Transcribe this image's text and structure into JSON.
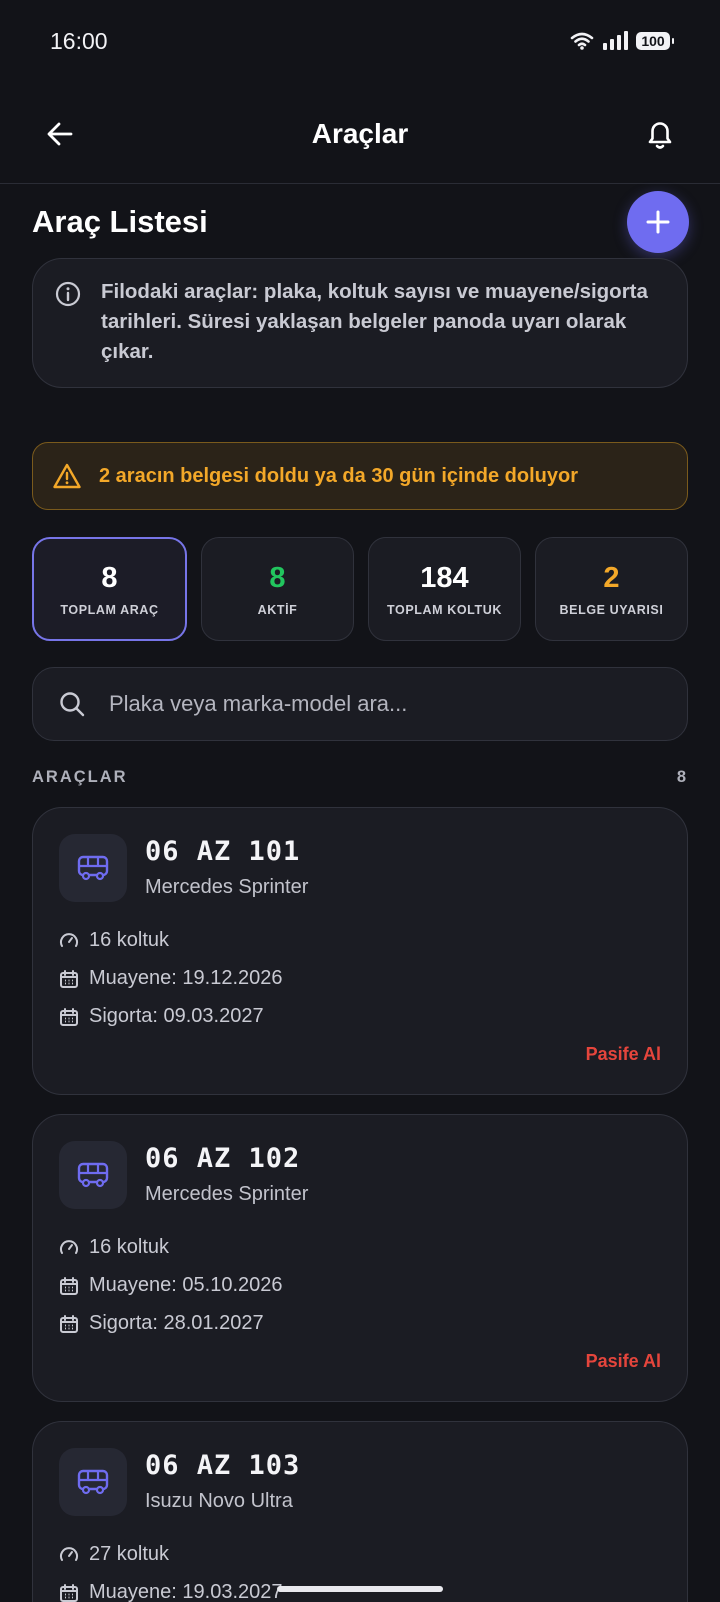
{
  "status_bar": {
    "time": "16:00",
    "battery": "100"
  },
  "header": {
    "title": "Araçlar"
  },
  "section": {
    "title": "Araç Listesi"
  },
  "info": {
    "text": "Filodaki araçlar: plaka, koltuk sayısı ve muayene/sigorta tarihleri. Süresi yaklaşan belgeler panoda uyarı olarak çıkar."
  },
  "warning": {
    "text": "2 aracın belgesi doldu ya da 30 gün içinde doluyor"
  },
  "stats": [
    {
      "value": "8",
      "label": "TOPLAM ARAÇ",
      "color": "#ffffff"
    },
    {
      "value": "8",
      "label": "AKTİF",
      "color": "#22c55e"
    },
    {
      "value": "184",
      "label": "TOPLAM KOLTUK",
      "color": "#ffffff"
    },
    {
      "value": "2",
      "label": "BELGE UYARISI",
      "color": "#f3a829"
    }
  ],
  "search": {
    "placeholder": "Plaka veya marka-model ara..."
  },
  "list": {
    "title": "ARAÇLAR",
    "count": "8"
  },
  "vehicles": [
    {
      "plate": "06 AZ 101",
      "model": "Mercedes Sprinter",
      "seats": "16 koltuk",
      "inspection": "Muayene: 19.12.2026",
      "insurance": "Sigorta: 09.03.2027",
      "action": "Pasife Al"
    },
    {
      "plate": "06 AZ 102",
      "model": "Mercedes Sprinter",
      "seats": "16 koltuk",
      "inspection": "Muayene: 05.10.2026",
      "insurance": "Sigorta: 28.01.2027",
      "action": "Pasife Al"
    },
    {
      "plate": "06 AZ 103",
      "model": "Isuzu Novo Ultra",
      "seats": "27 koltuk",
      "inspection": "Muayene: 19.03.2027",
      "insurance": "",
      "action": ""
    }
  ],
  "colors": {
    "accent": "#6f6cf0",
    "warning": "#f3a829",
    "danger": "#e5453c",
    "success": "#22c55e"
  },
  "icons": [
    "back-arrow-icon",
    "bell-icon",
    "plus-icon",
    "info-icon",
    "warning-triangle-icon",
    "search-icon",
    "bus-icon",
    "gauge-icon",
    "calendar-icon",
    "wifi-icon",
    "signal-icon",
    "battery-icon"
  ]
}
